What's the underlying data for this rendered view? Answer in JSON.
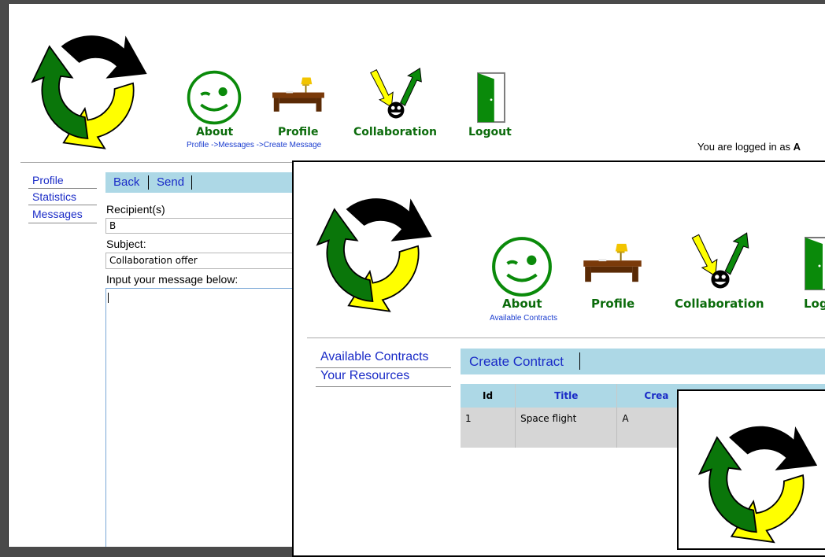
{
  "nav": {
    "about": "About",
    "profile": "Profile",
    "collaboration": "Collaboration",
    "logout": "Logout"
  },
  "window1": {
    "breadcrumb": "Profile ->Messages ->Create Message",
    "logged_in_prefix": "You are logged in as ",
    "logged_in_user": "A",
    "sidebar": [
      "Profile",
      "Statistics",
      "Messages"
    ],
    "toolbar": {
      "back": "Back",
      "send": "Send"
    },
    "form": {
      "recipients_label": "Recipient(s)",
      "recipients_value": "B",
      "subject_label": "Subject:",
      "subject_value": "Collaboration offer",
      "message_label": "Input your message below:"
    }
  },
  "window2": {
    "breadcrumb": "Available Contracts",
    "logout_partial": "Log",
    "sidebar": [
      "Available Contracts",
      "Your Resources"
    ],
    "toolbar": {
      "create": "Create Contract"
    },
    "table": {
      "headers": [
        "Id",
        "Title",
        "Crea"
      ],
      "rows": [
        [
          "1",
          "Space flight",
          "A"
        ]
      ]
    }
  },
  "colors": {
    "green": "#0b6b0b",
    "yellow": "#ffff00",
    "toolbar_bg": "#add8e6",
    "link": "#1a2bc7"
  }
}
